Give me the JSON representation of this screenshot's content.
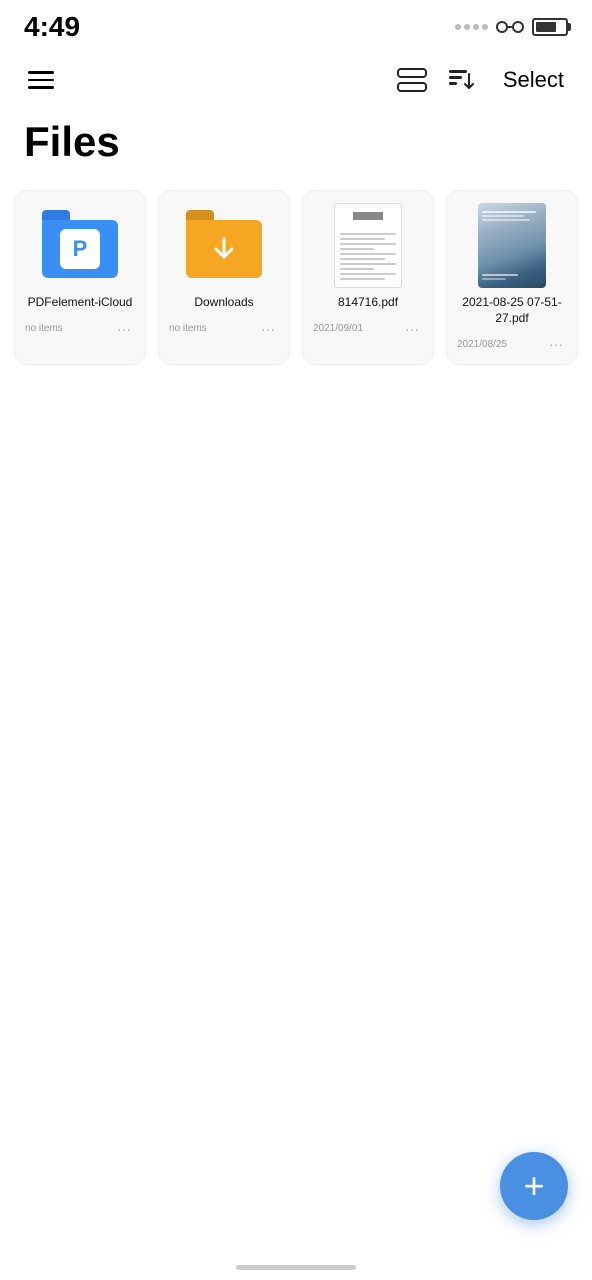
{
  "statusBar": {
    "time": "4:49",
    "battery": 70
  },
  "navBar": {
    "selectLabel": "Select"
  },
  "page": {
    "title": "Files"
  },
  "files": [
    {
      "id": "pdfelem",
      "name": "PDFelement-iCloud",
      "type": "folder-blue",
      "meta": "no items",
      "date": "",
      "isFolder": true
    },
    {
      "id": "downloads",
      "name": "Downloads",
      "type": "folder-yellow",
      "meta": "no items",
      "date": "",
      "isFolder": true
    },
    {
      "id": "pdf1",
      "name": "814716.pdf",
      "type": "pdf",
      "meta": "",
      "date": "2021/09/01",
      "isFolder": false
    },
    {
      "id": "pdf2",
      "name": "2021-08-25 07-51-27.pdf",
      "type": "image",
      "meta": "",
      "date": "2021/08/25",
      "isFolder": false
    }
  ],
  "fab": {
    "label": "+"
  },
  "icons": {
    "hamburger": "☰",
    "more": "···",
    "plus": "+"
  }
}
